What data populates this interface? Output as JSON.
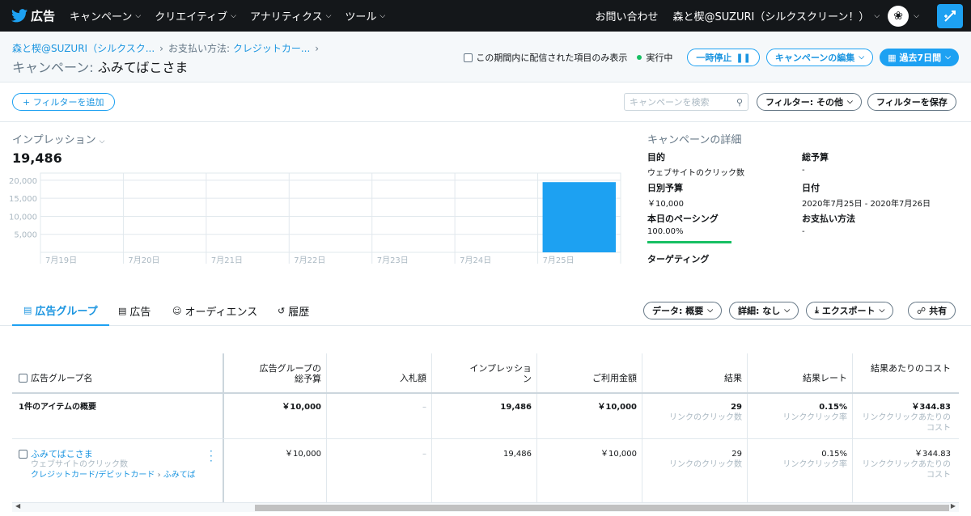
{
  "topbar": {
    "brand": "広告",
    "nav": [
      "キャンペーン",
      "クリエイティブ",
      "アナリティクス",
      "ツール"
    ],
    "help": "お問い合わせ",
    "account": "森と楔@SUZURI（シルクスクリーン！）"
  },
  "header": {
    "crumb1": "森と楔@SUZURI（シルクスク...",
    "crumb2_label": "お支払い方法:",
    "crumb2": "クレジットカー...",
    "title_label": "キャンペーン:",
    "title": "ふみてばこさま",
    "period_only": "この期間内に配信された項目のみ表示",
    "status": "実行中",
    "pause": "一時停止",
    "edit": "キャンペーンの編集",
    "range": "過去7日間"
  },
  "filterbar": {
    "add_filter": "+ フィルターを追加",
    "search_placeholder": "キャンペーンを検索",
    "filter_other": "フィルター: その他",
    "save_filter": "フィルターを保存"
  },
  "metric": {
    "label": "インプレッション",
    "value": "19,486"
  },
  "chart_data": {
    "type": "bar",
    "categories": [
      "7月19日",
      "7月20日",
      "7月21日",
      "7月22日",
      "7月23日",
      "7月24日",
      "7月25日"
    ],
    "values": [
      0,
      0,
      0,
      0,
      0,
      0,
      19486
    ],
    "yticks": [
      "20,000",
      "15,000",
      "10,000",
      "5,000"
    ],
    "ylim": [
      0,
      22000
    ],
    "grid": true,
    "color": "#1da1f2"
  },
  "details": {
    "title": "キャンペーンの詳細",
    "objective_k": "目的",
    "objective_v": "ウェブサイトのクリック数",
    "total_k": "総予算",
    "total_v": "-",
    "daily_k": "日別予算",
    "daily_v": "￥10,000",
    "date_k": "日付",
    "date_v": "2020年7月25日 - 2020年7月26日",
    "pacing_k": "本日のペーシング",
    "pacing_v": "100.00%",
    "payment_k": "お支払い方法",
    "payment_v": "-",
    "targeting_k": "ターゲティング"
  },
  "tabs": {
    "adgroups": "広告グループ",
    "ads": "広告",
    "audience": "オーディエンス",
    "history": "履歴",
    "data": "データ: 概要",
    "detail": "詳細: なし",
    "export": "エクスポート",
    "share": "共有"
  },
  "table": {
    "headers": {
      "name": "広告グループ名",
      "budget": "広告グループの総予算",
      "bid": "入札額",
      "impressions": "インプレッション",
      "spend": "ご利用金額",
      "results": "結果",
      "rate": "結果レート",
      "cpr": "結果あたりのコスト"
    },
    "summary": {
      "name": "1件のアイテムの概要",
      "budget": "￥10,000",
      "bid": "–",
      "impressions": "19,486",
      "spend": "￥10,000",
      "results": "29",
      "results_sub": "リンクのクリック数",
      "rate": "0.15%",
      "rate_sub": "リンククリック率",
      "cpr": "￥344.83",
      "cpr_sub": "リンククリックあたりのコスト"
    },
    "row": {
      "name": "ふみてばこさま",
      "objective": "ウェブサイトのクリック数",
      "payment": "クレジットカード/デビットカード",
      "crumb": "ふみてば",
      "budget": "￥10,000",
      "bid": "–",
      "impressions": "19,486",
      "spend": "￥10,000",
      "results": "29",
      "results_sub": "リンクのクリック数",
      "rate": "0.15%",
      "rate_sub": "リンククリック率",
      "cpr": "￥344.83",
      "cpr_sub": "リンククリックあたりのコスト"
    }
  }
}
